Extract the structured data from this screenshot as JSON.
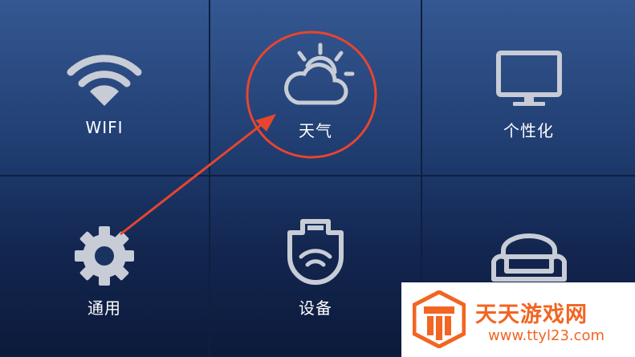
{
  "tiles": [
    {
      "label": "WIFI",
      "icon": "wifi-icon"
    },
    {
      "label": "天气",
      "icon": "weather-icon"
    },
    {
      "label": "个性化",
      "icon": "monitor-icon"
    },
    {
      "label": "通用",
      "icon": "gear-icon"
    },
    {
      "label": "设备",
      "icon": "device-icon"
    },
    {
      "label": "",
      "icon": "sofa-icon"
    }
  ],
  "annotation": {
    "color": "#e8452e",
    "highlight_target": "天气"
  },
  "watermark": {
    "title": "天天游戏网",
    "url": "www.ttyl23.com",
    "color": "#f26522"
  }
}
